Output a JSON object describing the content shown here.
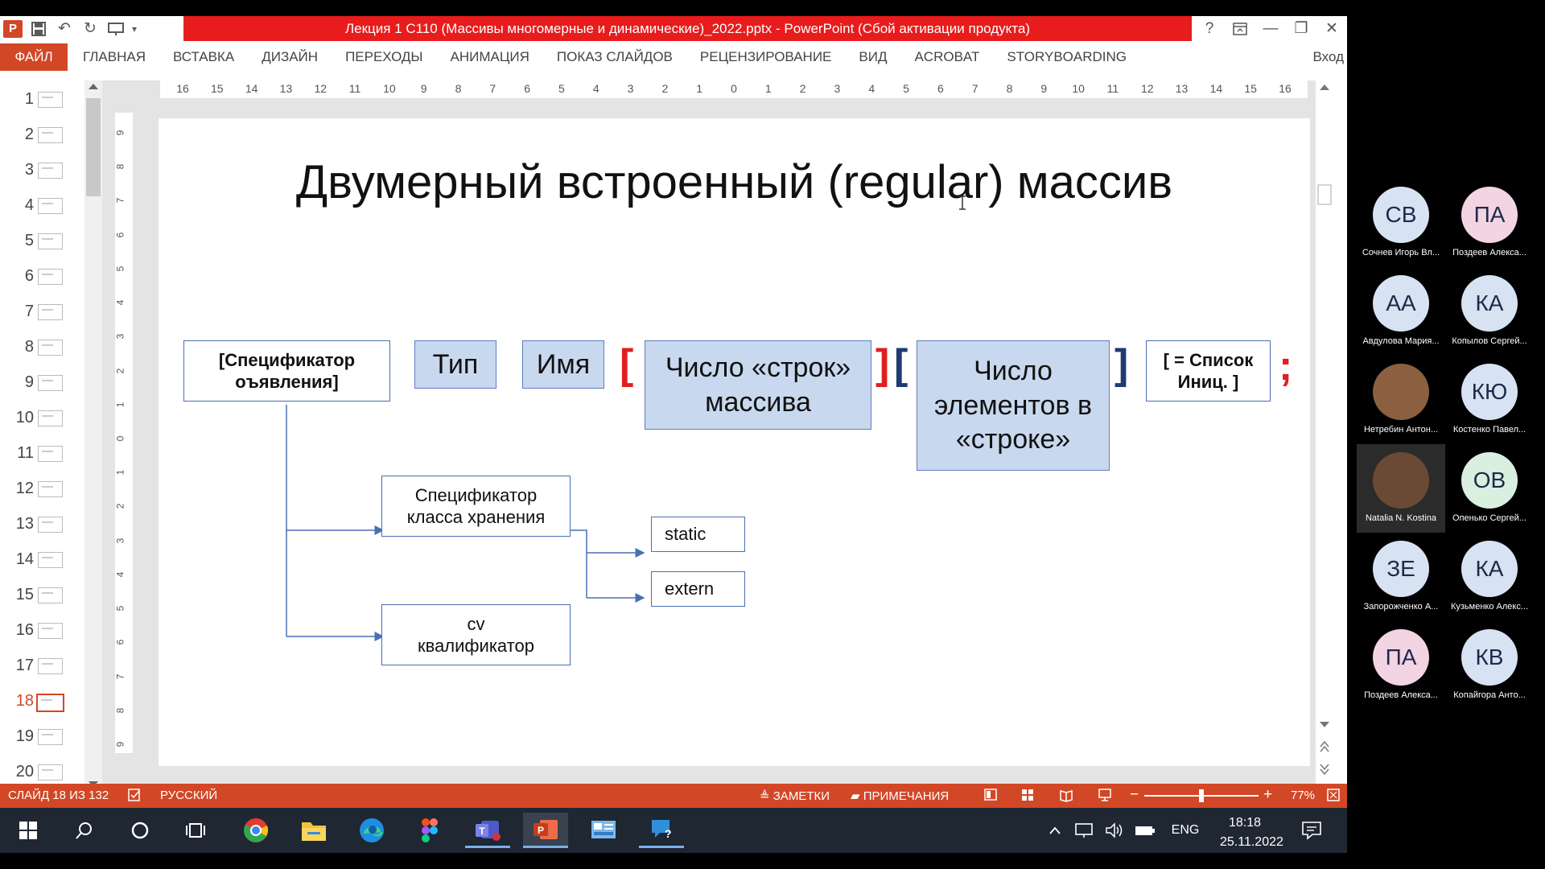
{
  "window": {
    "title": "Лекция 1 С110 (Массивы многомерные и динамические)_2022.pptx - PowerPoint (Сбой активации продукта)",
    "title_bar_color": "#e81c1c",
    "accent": "#d24726",
    "help": "?",
    "controls": {
      "minimize": "—",
      "restore": "❐",
      "close": "✕"
    }
  },
  "qat": {
    "app_icon": "P",
    "save": "💾",
    "undo": "↶",
    "redo": "↻",
    "present": "▢",
    "more": "▾"
  },
  "ribbon": {
    "file_tab": "ФАЙЛ",
    "tabs": [
      "ГЛАВНАЯ",
      "ВСТАВКА",
      "ДИЗАЙН",
      "ПЕРЕХОДЫ",
      "АНИМАЦИЯ",
      "ПОКАЗ СЛАЙДОВ",
      "РЕЦЕНЗИРОВАНИЕ",
      "ВИД",
      "ACROBAT",
      "STORYBOARDING"
    ],
    "signin": "Вход"
  },
  "thumbnails": {
    "numbers": [
      "1",
      "2",
      "3",
      "4",
      "5",
      "6",
      "7",
      "8",
      "9",
      "10",
      "11",
      "12",
      "13",
      "14",
      "15",
      "16",
      "17",
      "18",
      "19",
      "20"
    ],
    "active_index": 17
  },
  "ruler": {
    "h_labels": [
      "16",
      "15",
      "14",
      "13",
      "12",
      "11",
      "10",
      "9",
      "8",
      "7",
      "6",
      "5",
      "4",
      "3",
      "2",
      "1",
      "0",
      "1",
      "2",
      "3",
      "4",
      "5",
      "6",
      "7",
      "8",
      "9",
      "10",
      "11",
      "12",
      "13",
      "14",
      "15",
      "16"
    ],
    "v_labels": [
      "9",
      "8",
      "7",
      "6",
      "5",
      "4",
      "3",
      "2",
      "1",
      "0",
      "1",
      "2",
      "3",
      "4",
      "5",
      "6",
      "7",
      "8",
      "9"
    ]
  },
  "slide": {
    "title": "Двумерный встроенный (regular) массив",
    "spec": "[Спецификатор оъявления]",
    "type": "Тип",
    "name": "Имя",
    "bracket_open": "[",
    "bracket_close": "]",
    "rows": "Число «строк» массива",
    "cols": "Число элементов в «строке»",
    "init": "[ = Список Иниц. ]",
    "semicolon": ";",
    "storage": "Спецификатор класса хранения",
    "static": "static",
    "extern": "extern",
    "cv": "cv квалификатор",
    "red_color": "#e02020",
    "navy_color": "#1f3b73"
  },
  "statusbar": {
    "slide_info": "СЛАЙД 18 ИЗ 132",
    "language": "РУССКИЙ",
    "notes": "ЗАМЕТКИ",
    "comments": "ПРИМЕЧАНИЯ",
    "zoom": "77%",
    "zoom_fraction": 0.5
  },
  "taskbar": {
    "language": "ENG",
    "time": "18:18",
    "date": "25.11.2022",
    "icons": [
      "windows-start",
      "search",
      "cortana",
      "task-view",
      "chrome",
      "file-explorer",
      "edge",
      "figma",
      "teams",
      "powerpoint",
      "control-panel",
      "quick-assist"
    ]
  },
  "participants": [
    {
      "initials": "СВ",
      "name": "Сочнев Игорь Вл...",
      "color": "#d7e3f2"
    },
    {
      "initials": "ПА",
      "name": "Поздеев Алекса...",
      "color": "#f3d4e3"
    },
    {
      "initials": "АА",
      "name": "Авдулова Мария...",
      "color": "#d7e3f2"
    },
    {
      "initials": "КА",
      "name": "Копылов Сергей...",
      "color": "#d7e3f2"
    },
    {
      "initials": "",
      "name": "Нетребин Антон...",
      "color": "#8a6040"
    },
    {
      "initials": "КЮ",
      "name": "Костенко Павел...",
      "color": "#d7e3f2"
    },
    {
      "initials": "",
      "name": "Natalia N. Kostina",
      "color": "#6b4a35"
    },
    {
      "initials": "ОВ",
      "name": "Опенько Сергей...",
      "color": "#d9efe0"
    },
    {
      "initials": "ЗЕ",
      "name": "Запорожченко А...",
      "color": "#d7e3f2"
    },
    {
      "initials": "КА",
      "name": "Кузьменко Алекс...",
      "color": "#d7e3f2"
    },
    {
      "initials": "ПА",
      "name": "Поздеев Алекса...",
      "color": "#f3d4e3"
    },
    {
      "initials": "КВ",
      "name": "Копайгора Анто...",
      "color": "#d7e3f2"
    }
  ]
}
